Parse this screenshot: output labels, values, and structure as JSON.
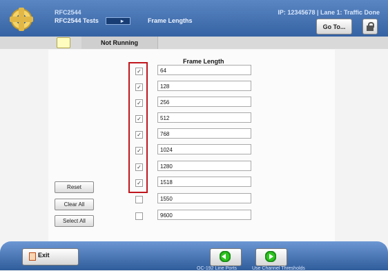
{
  "header": {
    "app": "RFC2544",
    "breadcrumb": "RFC2544 Tests",
    "separator": "       ▸  ",
    "page": "Frame Lengths",
    "right_info": "IP: 12345678 | Lane 1: Traffic Done",
    "goto_label": "Go To..."
  },
  "tabs": {
    "status": "Not Running"
  },
  "content": {
    "title": "Frame Length",
    "rows": [
      {
        "checked": true,
        "value": "64"
      },
      {
        "checked": true,
        "value": "128"
      },
      {
        "checked": true,
        "value": "256"
      },
      {
        "checked": true,
        "value": "512"
      },
      {
        "checked": true,
        "value": "768"
      },
      {
        "checked": true,
        "value": "1024"
      },
      {
        "checked": true,
        "value": "1280"
      },
      {
        "checked": true,
        "value": "1518"
      },
      {
        "checked": false,
        "value": "1550"
      },
      {
        "checked": false,
        "value": "9600"
      }
    ]
  },
  "buttons": {
    "reset": "Reset",
    "clear_all": "Clear All",
    "select_all": "Select All"
  },
  "footer": {
    "exit_label": "Exit",
    "left_hint": "OC-192 Line Ports",
    "right_hint": "Use Channel Thresholds"
  },
  "colors": {
    "header_blue": "#2d5a9b",
    "highlight": "#c0161c",
    "arrow_green": "#2ec41f"
  }
}
